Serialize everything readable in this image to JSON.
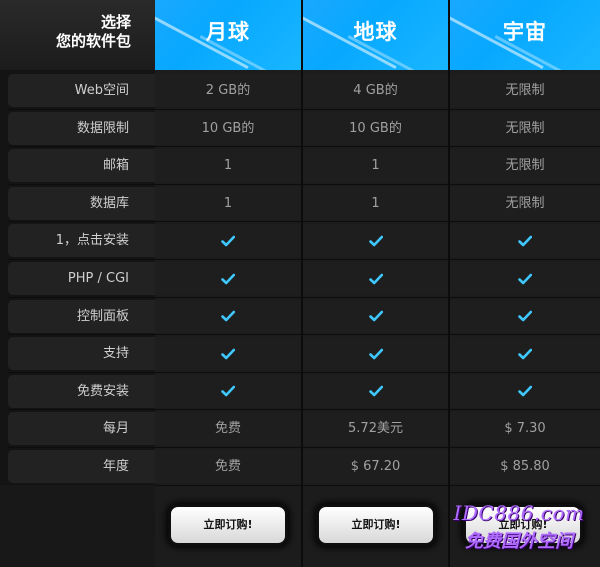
{
  "header": {
    "corner_line1": "选择",
    "corner_line2": "您的软件包",
    "plans": [
      "月球",
      "地球",
      "宇宙"
    ]
  },
  "rows": [
    {
      "label": "Web空间",
      "values": [
        "2 GB的",
        "4 GB的",
        "无限制"
      ]
    },
    {
      "label": "数据限制",
      "values": [
        "10 GB的",
        "10 GB的",
        "无限制"
      ]
    },
    {
      "label": "邮箱",
      "values": [
        "1",
        "1",
        "无限制"
      ]
    },
    {
      "label": "数据库",
      "values": [
        "1",
        "1",
        "无限制"
      ]
    },
    {
      "label": "1，点击安装",
      "values": [
        "check",
        "check",
        "check"
      ]
    },
    {
      "label": "PHP / CGI",
      "values": [
        "check",
        "check",
        "check"
      ]
    },
    {
      "label": "控制面板",
      "values": [
        "check",
        "check",
        "check"
      ]
    },
    {
      "label": "支持",
      "values": [
        "check",
        "check",
        "check"
      ]
    },
    {
      "label": "免费安装",
      "values": [
        "check",
        "check",
        "check"
      ]
    },
    {
      "label": "每月",
      "values": [
        "免费",
        "5.72美元",
        "$ 7.30"
      ]
    },
    {
      "label": "年度",
      "values": [
        "免费",
        "$ 67.20",
        "$ 85.80"
      ]
    }
  ],
  "buttons": [
    "立即订购!",
    "立即订购!",
    "立即订购!"
  ],
  "watermark": {
    "line1": "IDC886.com",
    "line2": "免费国外空间"
  },
  "colors": {
    "accent": "#08a8ff",
    "check": "#3ec8ff"
  }
}
